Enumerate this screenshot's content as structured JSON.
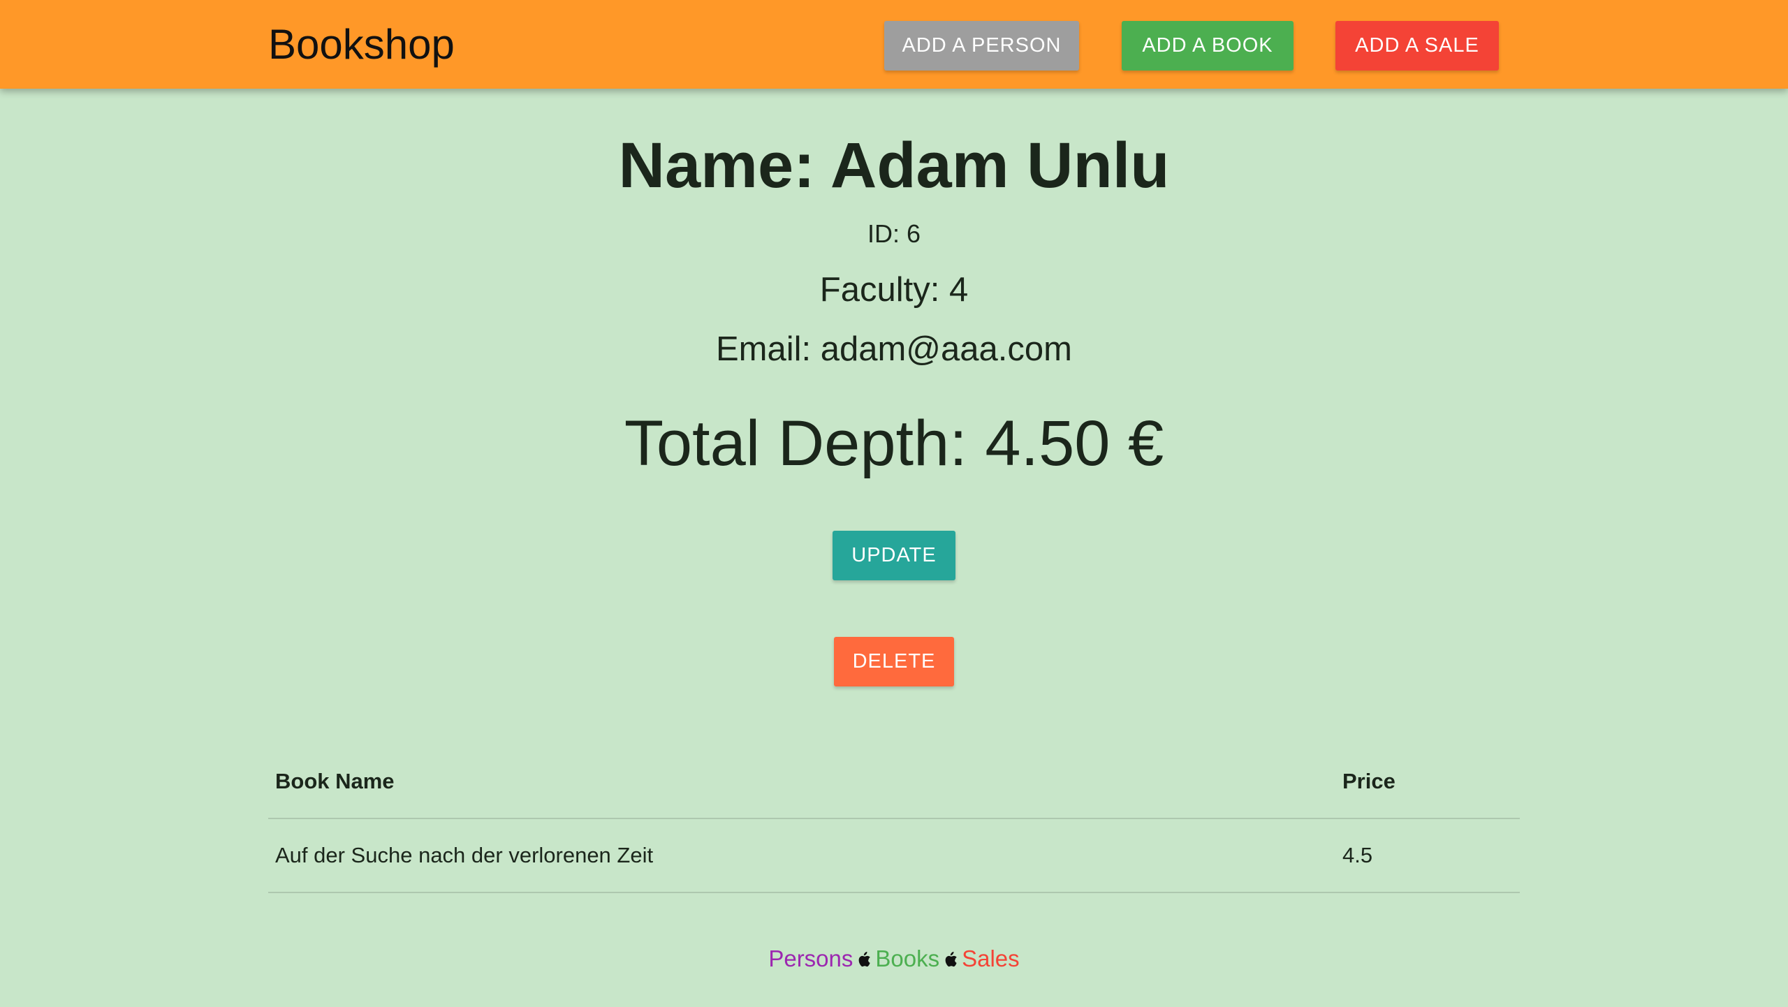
{
  "navbar": {
    "brand": "Bookshop",
    "buttons": {
      "add_person": "ADD A PERSON",
      "add_book": "ADD A BOOK",
      "add_sale": "ADD A SALE"
    }
  },
  "person": {
    "name": "Name: Adam Unlu",
    "id": "ID: 6",
    "faculty": "Faculty: 4",
    "email": "Email: adam@aaa.com",
    "total_depth": "Total Depth: 4.50 €"
  },
  "actions": {
    "update": "UPDATE",
    "delete": "DELETE"
  },
  "table": {
    "headers": [
      "Book Name",
      "Price"
    ],
    "rows": [
      [
        "Auf der Suche nach der verlorenen Zeit",
        "4.5"
      ]
    ]
  },
  "footer": {
    "persons": "Persons",
    "books": "Books",
    "sales": "Sales",
    "separator_icon": "apple-icon"
  },
  "colors": {
    "navbar": "#ff9828",
    "background": "#c8e6c9",
    "add_person": "#9e9e9e",
    "add_book": "#4caf50",
    "add_sale": "#f44336",
    "update": "#26a69a",
    "delete": "#ff6a3d",
    "persons_link": "#9c27b0",
    "books_link": "#4caf50",
    "sales_link": "#f44336"
  }
}
